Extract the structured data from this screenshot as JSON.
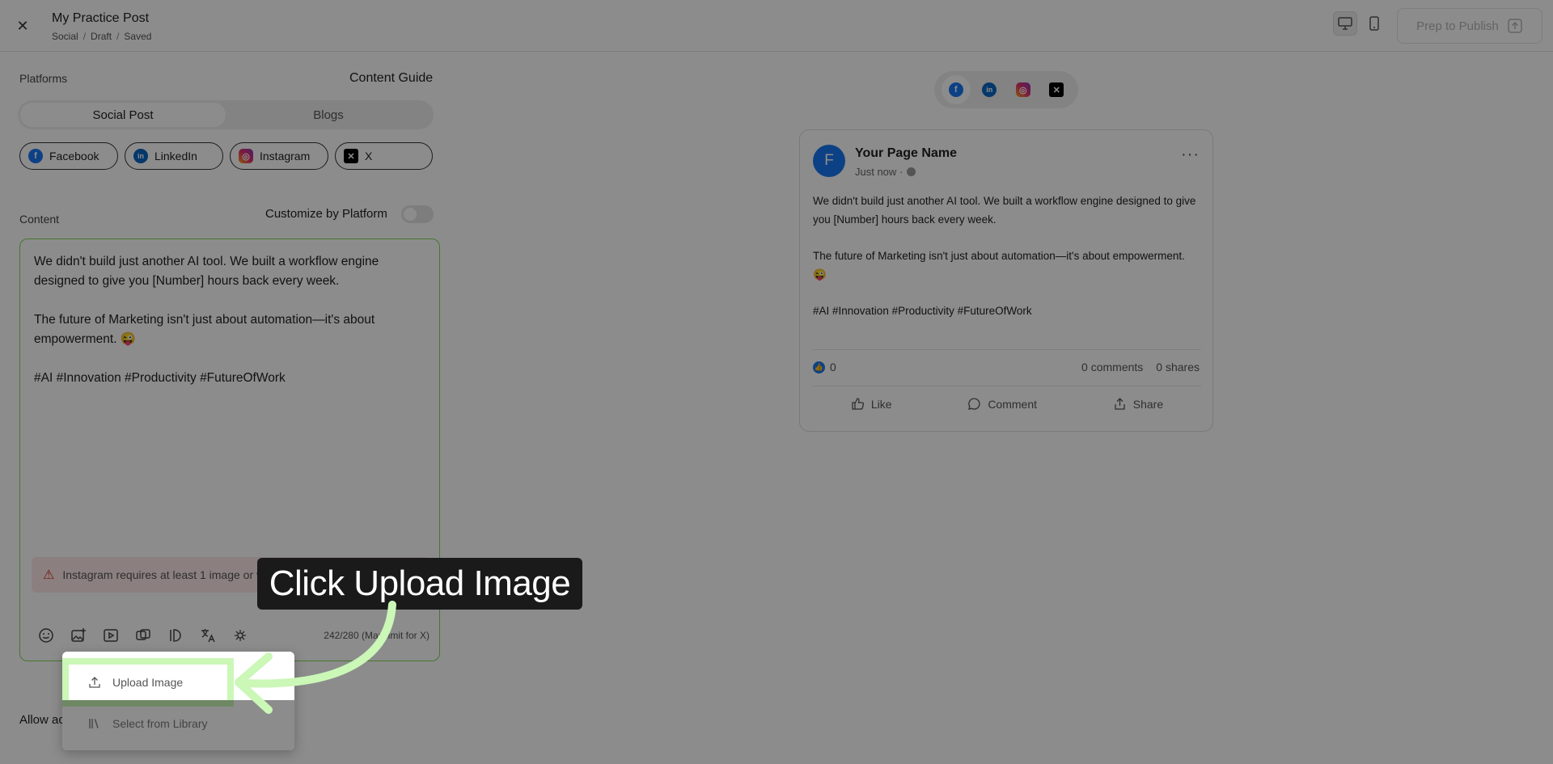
{
  "header": {
    "title": "My Practice Post",
    "breadcrumb": [
      "Social",
      "Draft",
      "Saved"
    ],
    "publish_label": "Prep to Publish"
  },
  "left": {
    "platforms_label": "Platforms",
    "content_guide_label": "Content Guide",
    "type_tabs": [
      {
        "label": "Social Post",
        "active": true
      },
      {
        "label": "Blogs",
        "active": false
      }
    ],
    "platforms": [
      {
        "label": "Facebook",
        "icon": "facebook-icon"
      },
      {
        "label": "LinkedIn",
        "icon": "linkedin-icon"
      },
      {
        "label": "Instagram",
        "icon": "instagram-icon"
      },
      {
        "label": "X",
        "icon": "x-icon"
      }
    ],
    "content_label": "Content",
    "customize_label": "Customize by Platform",
    "editor": {
      "paragraph_1": "We didn't build just another AI tool. We built a workflow engine designed to give you [Number] hours back every week.",
      "paragraph_2": "The future of Marketing isn't just about automation—it's about empowerment. 😜",
      "paragraph_3": "#AI #Innovation #Productivity #FutureOfWork",
      "warning": "Instagram requires at least 1 image or video",
      "char_count": "242/280 (Max limit for X)"
    },
    "allow_label": "Allow ac"
  },
  "preview": {
    "page_name": "Your Page Name",
    "avatar_letter": "F",
    "timestamp": "Just now ·",
    "paragraph_1": "We didn't build just another AI tool. We built a workflow engine designed to give you [Number] hours back every week.",
    "paragraph_2": "The future of Marketing isn't just about automation—it's about empowerment. 😜",
    "paragraph_3": "#AI #Innovation #Productivity #FutureOfWork",
    "likes": "0",
    "comments": "0 comments",
    "shares": "0 shares",
    "action_like": "Like",
    "action_comment": "Comment",
    "action_share": "Share"
  },
  "upload_menu": {
    "upload_label": "Upload Image",
    "library_label": "Select from Library"
  },
  "callout": {
    "text": "Click Upload Image"
  },
  "colors": {
    "accent_green": "#7ed957",
    "highlight_green": "#cbf7b7",
    "facebook_blue": "#1877f2"
  }
}
